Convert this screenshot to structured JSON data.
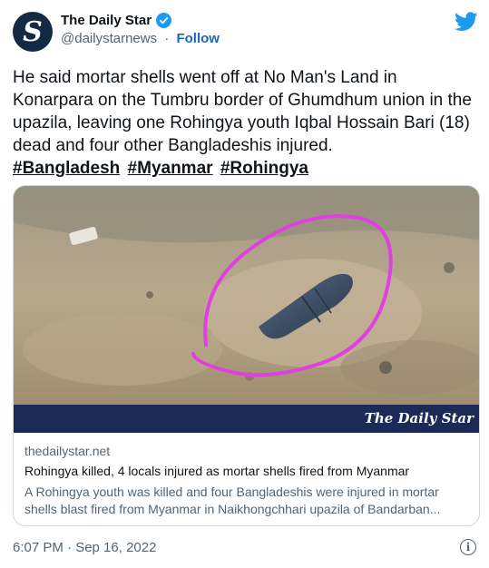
{
  "author": {
    "avatar_letter": "S",
    "name": "The Daily Star",
    "handle": "@dailystarnews",
    "separator": "·",
    "follow_label": "Follow",
    "verified_icon": "verified-badge-icon"
  },
  "brand_icon": "twitter-bird-icon",
  "tweet": {
    "text": "He said mortar shells went off at No Man's Land in Konarpara on the Tumbru border of Ghumdhum union in the upazila, leaving one Rohingya youth Iqbal Hossain Bari (18) dead and four other Bangladeshis injured.",
    "hashtags": [
      "#Bangladesh",
      "#Myanmar",
      "#Rohingya"
    ]
  },
  "media": {
    "photo_description_icon": "mortar-shell-photo",
    "watermark": "The Daily Star",
    "domain": "thedailystar.net",
    "title": "Rohingya killed, 4 locals injured as mortar shells fired from Myanmar",
    "description": "A Rohingya youth was killed and four Bangladeshis were injured in mortar shells blast fired from Myanmar in Naikhongchhari upazila of Bandarban..."
  },
  "footer": {
    "timestamp": "6:07 PM · Sep 16, 2022",
    "info_icon": "info-icon"
  },
  "colors": {
    "accent_blue": "#1d9bf0",
    "text": "#0f1419",
    "muted": "#536471",
    "brand_bar": "#1b2a56",
    "circle_highlight": "#e040e0"
  }
}
